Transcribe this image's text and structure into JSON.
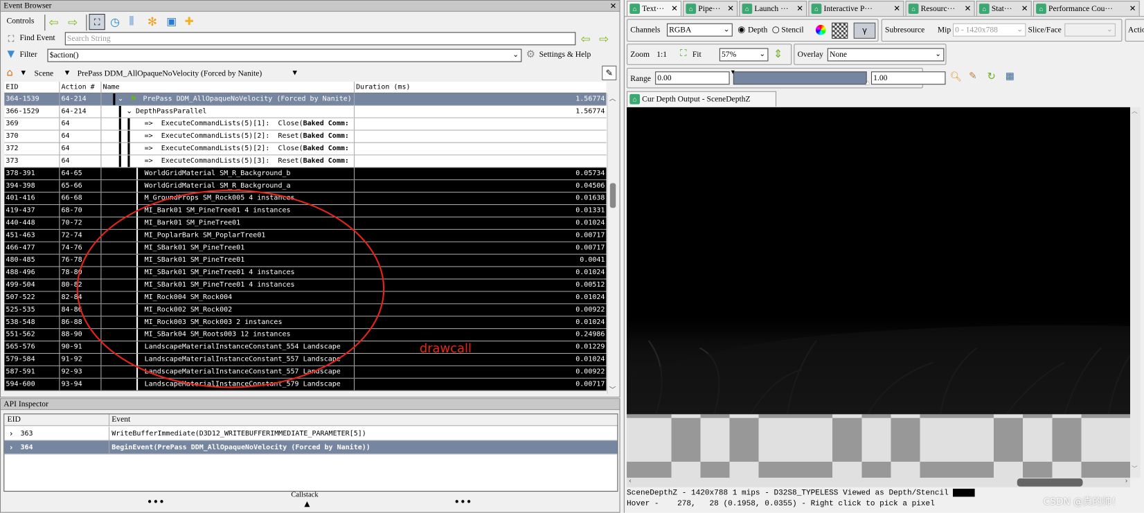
{
  "event_browser": {
    "title": "Event Browser",
    "controls_label": "Controls",
    "find_label": "Find Event",
    "find_placeholder": "Search String",
    "filter_label": "Filter",
    "filter_value": "$action()",
    "settings_label": "Settings & Help",
    "breadcrumb": [
      "Scene",
      "PrePass DDM_AllOpaqueNoVelocity (Forced by Nanite)"
    ],
    "columns": [
      "EID",
      "Action #",
      "Name",
      "Duration (ms)"
    ],
    "rows": [
      {
        "eid": "364-1539",
        "action": "64-214",
        "name": "PrePass DDM_AllOpaqueNoVelocity (Forced by Nanite)",
        "duration": "1.56774",
        "style": "sel",
        "kind": "root"
      },
      {
        "eid": "366-1529",
        "action": "64-214",
        "name": "DepthPassParallel",
        "duration": "1.56774",
        "style": "white",
        "kind": "group"
      },
      {
        "eid": "369",
        "action": "64",
        "name": "=>  ExecuteCommandLists(5)[1]:  Close(",
        "bold": "Baked Comm:",
        "duration": "",
        "style": "white",
        "kind": "cmd"
      },
      {
        "eid": "370",
        "action": "64",
        "name": "=>  ExecuteCommandLists(5)[2]:  Reset(",
        "bold": "Baked Comm:",
        "duration": "",
        "style": "white",
        "kind": "cmd"
      },
      {
        "eid": "372",
        "action": "64",
        "name": "=>  ExecuteCommandLists(5)[2]:  Close(",
        "bold": "Baked Comm:",
        "duration": "",
        "style": "white",
        "kind": "cmd"
      },
      {
        "eid": "373",
        "action": "64",
        "name": "=>  ExecuteCommandLists(5)[3]:  Reset(",
        "bold": "Baked Comm:",
        "duration": "",
        "style": "white",
        "kind": "cmd"
      },
      {
        "eid": "378-391",
        "action": "64-65",
        "name": "WorldGridMaterial SM_R_Background_b",
        "duration": "0.05734",
        "style": "black"
      },
      {
        "eid": "394-398",
        "action": "65-66",
        "name": "WorldGridMaterial SM_R_Background_a",
        "duration": "0.04506",
        "style": "black"
      },
      {
        "eid": "401-416",
        "action": "66-68",
        "name": "M_GroundProps SM_Rock005 4 instances",
        "duration": "0.01638",
        "style": "black"
      },
      {
        "eid": "419-437",
        "action": "68-70",
        "name": "MI_Bark01 SM_PineTree01 4 instances",
        "duration": "0.01331",
        "style": "black"
      },
      {
        "eid": "440-448",
        "action": "70-72",
        "name": "MI_Bark01 SM_PineTree01",
        "duration": "0.01024",
        "style": "black"
      },
      {
        "eid": "451-463",
        "action": "72-74",
        "name": "MI_PoplarBark SM_PoplarTree01",
        "duration": "0.00717",
        "style": "black"
      },
      {
        "eid": "466-477",
        "action": "74-76",
        "name": "MI_SBark01 SM_PineTree01",
        "duration": "0.00717",
        "style": "black"
      },
      {
        "eid": "480-485",
        "action": "76-78",
        "name": "MI_SBark01 SM_PineTree01",
        "duration": "0.0041",
        "style": "black"
      },
      {
        "eid": "488-496",
        "action": "78-80",
        "name": "MI_SBark01 SM_PineTree01 4 instances",
        "duration": "0.01024",
        "style": "black"
      },
      {
        "eid": "499-504",
        "action": "80-82",
        "name": "MI_SBark01 SM_PineTree01 4 instances",
        "duration": "0.00512",
        "style": "black"
      },
      {
        "eid": "507-522",
        "action": "82-84",
        "name": "MI_Rock004 SM_Rock004",
        "duration": "0.01024",
        "style": "black"
      },
      {
        "eid": "525-535",
        "action": "84-86",
        "name": "MI_Rock002 SM_Rock002",
        "duration": "0.00922",
        "style": "black"
      },
      {
        "eid": "538-548",
        "action": "86-88",
        "name": "MI_Rock003 SM_Rock003 2 instances",
        "duration": "0.01024",
        "style": "black"
      },
      {
        "eid": "551-562",
        "action": "88-90",
        "name": "MI_SBark04 SM_Roots003 12 instances",
        "duration": "0.24986",
        "style": "black"
      },
      {
        "eid": "565-576",
        "action": "90-91",
        "name": "LandscapeMaterialInstanceConstant_554 Landscape",
        "duration": "0.01229",
        "style": "black"
      },
      {
        "eid": "579-584",
        "action": "91-92",
        "name": "LandscapeMaterialInstanceConstant_557 Landscape",
        "duration": "0.01024",
        "style": "black"
      },
      {
        "eid": "587-591",
        "action": "92-93",
        "name": "LandscapeMaterialInstanceConstant_557 Landscape",
        "duration": "0.00922",
        "style": "black"
      },
      {
        "eid": "594-600",
        "action": "93-94",
        "name": "LandscapeMaterialInstanceConstant_579 Landscape",
        "duration": "0.00717",
        "style": "black"
      }
    ],
    "annotation": "drawcall",
    "annotation_color": "#e8231a"
  },
  "api_inspector": {
    "title": "API Inspector",
    "columns": [
      "EID",
      "Event"
    ],
    "rows": [
      {
        "eid": "363",
        "event": "WriteBufferImmediate(D3D12_WRITEBUFFERIMMEDIATE_PARAMETER[5])",
        "selected": false
      },
      {
        "eid": "364",
        "event": "BeginEvent(PrePass DDM_AllOpaqueNoVelocity (Forced by Nanite))",
        "selected": true
      }
    ],
    "footer": {
      "left": "•••",
      "center": "Callstack",
      "right": "•••"
    }
  },
  "texture_viewer": {
    "tabs": [
      "Text···",
      "Pipe···",
      "Launch ···",
      "Interactive P···",
      "Resourc···",
      "Stat···",
      "Performance Cou···"
    ],
    "channels_label": "Channels",
    "channels_value": "RGBA",
    "depth_label": "Depth",
    "stencil_label": "Stencil",
    "depth_selected": true,
    "gamma_label": "γ",
    "subresource_label": "Subresource",
    "mip_label": "Mip",
    "mip_value": "0 - 1420x788",
    "slice_label": "Slice/Face",
    "actions_label": "Actio",
    "zoom_label": "Zoom",
    "zoom_1to1": "1:1",
    "fit_label": "Fit",
    "zoom_value": "57%",
    "overlay_label": "Overlay",
    "overlay_value": "None",
    "range_label": "Range",
    "range_min": "0.00",
    "range_max": "1.00",
    "image_tab": "Cur Depth Output - SceneDepthZ",
    "status_line1": "SceneDepthZ - 1420x788 1 mips - D32S8_TYPELESS Viewed as Depth/Stencil",
    "status_line2": "Hover -    278,   28 (0.1958, 0.0355) - Right click to pick a pixel"
  },
  "watermark": "CSDN @真的帅！",
  "colors": {
    "selection": "#7686a0",
    "accent_green": "#3aa870"
  }
}
